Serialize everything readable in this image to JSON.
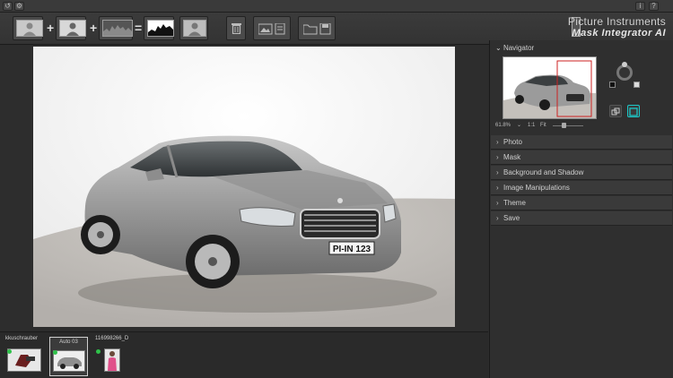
{
  "topbar": {
    "undo_label": "↺",
    "settings_label": "⚙",
    "info_label": "i",
    "help_label": "?"
  },
  "toolbar": {
    "plus1": "+",
    "plus2": "+",
    "equals": "=",
    "brand_line1": "Picture Instruments",
    "brand_line2": "Mask Integrator AI"
  },
  "colors": {
    "accent": "#1cc6c6",
    "status_green": "#2fc24a",
    "panel_bg": "#2f2f2f"
  },
  "photo": {
    "plate_text": "PI-IN 123"
  },
  "filmstrip": {
    "items": [
      {
        "label": "kkuschrauber",
        "selected": false
      },
      {
        "label": "Auto 03",
        "selected": true
      },
      {
        "label": "116998266_D",
        "selected": false
      }
    ]
  },
  "panel": {
    "navigator": {
      "title": "Navigator",
      "zoom_value": "61.8%",
      "ratio_label": "1:1",
      "fit_label": "Fit"
    },
    "sections": [
      {
        "label": "Photo"
      },
      {
        "label": "Mask"
      },
      {
        "label": "Background and Shadow"
      },
      {
        "label": "Image Manipulations"
      },
      {
        "label": "Theme"
      },
      {
        "label": "Save"
      }
    ]
  }
}
